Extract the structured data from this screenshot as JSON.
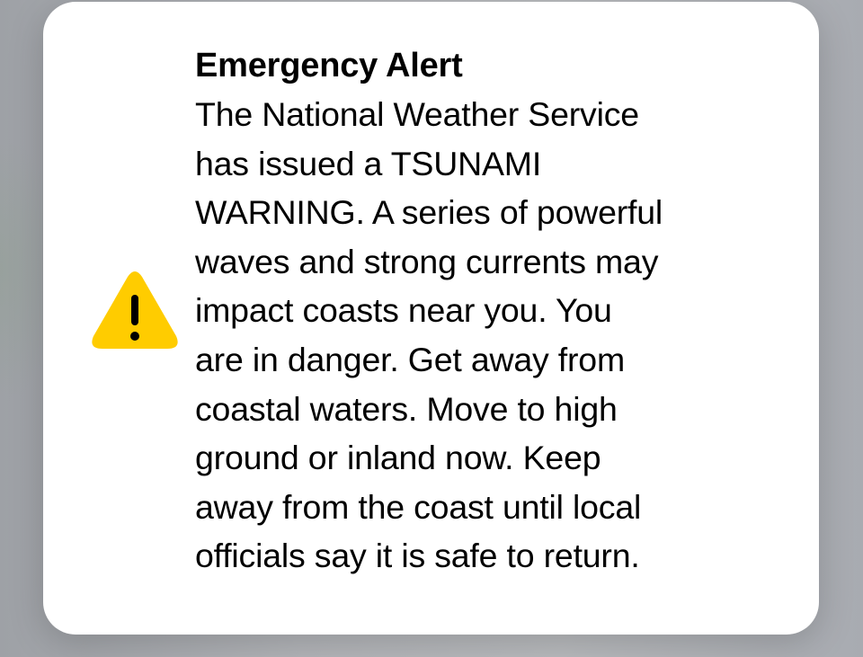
{
  "alert": {
    "title": "Emergency Alert",
    "icon": "warning-triangle-icon",
    "icon_color": "#FFCC00",
    "body_lines": [
      "The National Weather Service",
      "has issued a TSUNAMI",
      "WARNING. A series of powerful",
      "waves and strong currents may",
      "impact coasts near you. You",
      "are in danger. Get away from",
      "coastal waters. Move to high",
      "ground or inland now. Keep",
      "away from the coast until local",
      "officials say it is safe to return."
    ]
  }
}
